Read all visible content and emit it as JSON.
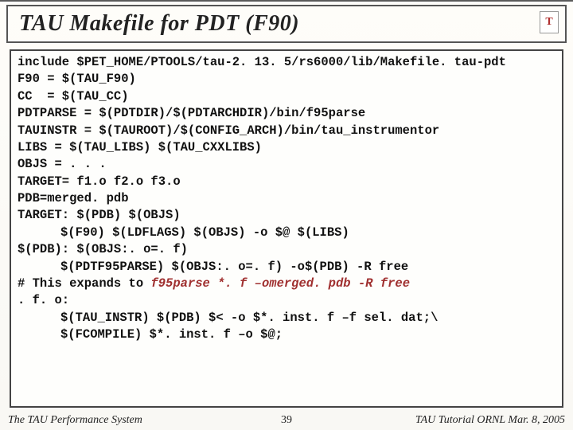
{
  "title": "TAU Makefile for PDT (F90)",
  "logo_text": "T",
  "code": {
    "l1": "include $PET_HOME/PTOOLS/tau-2. 13. 5/rs6000/lib/Makefile. tau-pdt",
    "l2": "F90 = $(TAU_F90)",
    "l3": "CC  = $(TAU_CC)",
    "l4": "PDTPARSE = $(PDTDIR)/$(PDTARCHDIR)/bin/f95parse",
    "l5": "TAUINSTR = $(TAUROOT)/$(CONFIG_ARCH)/bin/tau_instrumentor",
    "l6": "LIBS = $(TAU_LIBS) $(TAU_CXXLIBS)",
    "l7": "OBJS = . . .",
    "l8": "TARGET= f1.o f2.o f3.o",
    "l9": "PDB=merged. pdb",
    "l10": "TARGET: $(PDB) $(OBJS)",
    "l11": "$(F90) $(LDFLAGS) $(OBJS) -o $@ $(LIBS)",
    "l12": "$(PDB): $(OBJS:. o=. f)",
    "l13": "$(PDTF95PARSE) $(OBJS:. o=. f) -o$(PDB) -R free",
    "l14a": "# This expands to ",
    "l14b": "f95parse *. f –omerged. pdb -R free",
    "l15": ". f. o:",
    "l16": "$(TAU_INSTR) $(PDB) $< -o $*. inst. f –f sel. dat;\\",
    "l17": "$(FCOMPILE) $*. inst. f –o $@;"
  },
  "footer": {
    "left": "The TAU Performance System",
    "center": "39",
    "right": "TAU Tutorial ORNL Mar. 8, 2005"
  }
}
